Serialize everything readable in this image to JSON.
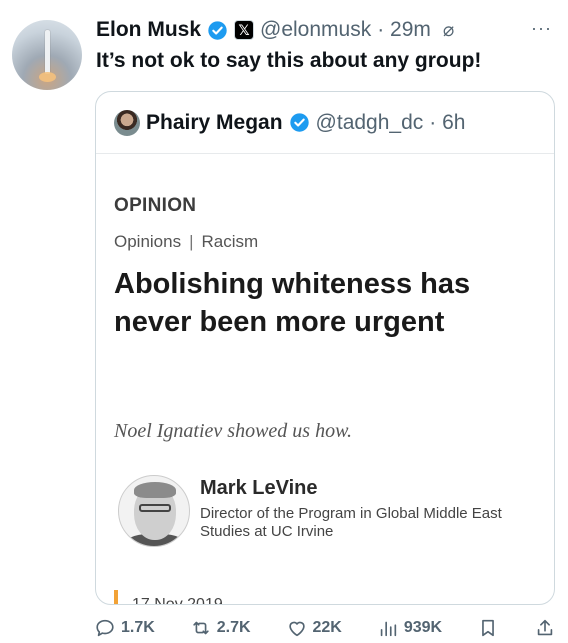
{
  "tweet": {
    "author_name": "Elon Musk",
    "author_handle": "@elonmusk",
    "time": "· 29m",
    "text": "It’s not ok to say this about any group!",
    "affiliate_badge": "𝕏"
  },
  "quoted": {
    "author_name": "Phairy Megan",
    "author_handle": "@tadgh_dc",
    "time": "· 6h",
    "article": {
      "kicker": "OPINION",
      "crumb_1": "Opinions",
      "crumb_sep": "|",
      "crumb_2": "Racism",
      "headline": "Abolishing whiteness has never been more urgent",
      "deck": "Noel Ignatiev showed us how.",
      "author_name": "Mark LeVine",
      "author_bio": "Director of the Program in Global Middle East Studies at UC Irvine",
      "date": "17 Nov 2019"
    }
  },
  "actions": {
    "replies": "1.7K",
    "reposts": "2.7K",
    "likes": "22K",
    "views": "939K"
  },
  "colors": {
    "verified_blue": "#1d9bf0",
    "muted": "#536471",
    "accent_bar": "#f2a236",
    "facebook_blue": "#1877f2",
    "whatsapp_green": "#25d366"
  }
}
